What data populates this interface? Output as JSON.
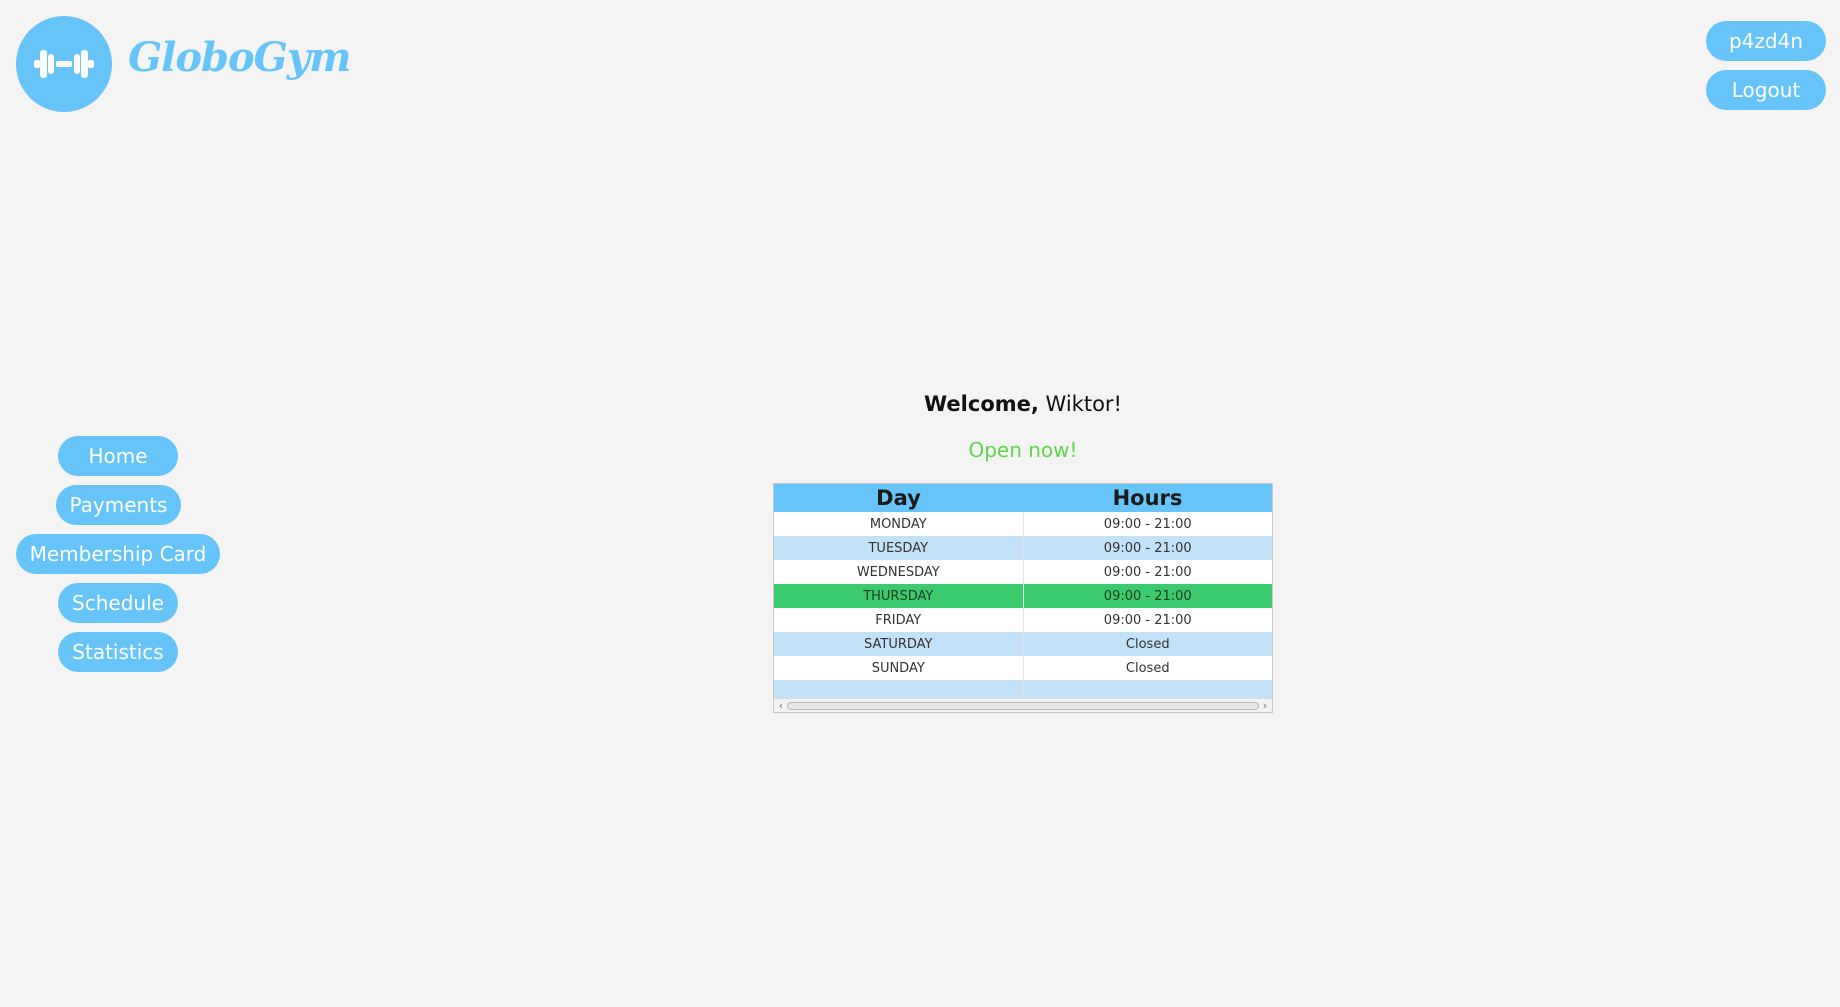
{
  "brand": {
    "name": "GloboGym",
    "logo_icon": "dumbbell-icon",
    "color": "#66c4f8"
  },
  "header": {
    "username": "p4zd4n",
    "logout_label": "Logout"
  },
  "sidebar": {
    "items": [
      {
        "label": "Home"
      },
      {
        "label": "Payments"
      },
      {
        "label": "Membership Card"
      },
      {
        "label": "Schedule"
      },
      {
        "label": "Statistics"
      }
    ]
  },
  "main": {
    "welcome_prefix": "Welcome,",
    "user_name": "Wiktor!",
    "status": "Open now!",
    "status_color": "#5fd64a",
    "table": {
      "headers": [
        "Day",
        "Hours"
      ],
      "rows": [
        {
          "day": "MONDAY",
          "hours": "09:00 - 21:00"
        },
        {
          "day": "TUESDAY",
          "hours": "09:00 - 21:00"
        },
        {
          "day": "WEDNESDAY",
          "hours": "09:00 - 21:00"
        },
        {
          "day": "THURSDAY",
          "hours": "09:00 - 21:00",
          "highlighted": true
        },
        {
          "day": "FRIDAY",
          "hours": "09:00 - 21:00"
        },
        {
          "day": "SATURDAY",
          "hours": "Closed"
        },
        {
          "day": "SUNDAY",
          "hours": "Closed"
        }
      ],
      "highlight_color": "#3ccb6c",
      "stripe_color": "#c2e2f8"
    }
  }
}
